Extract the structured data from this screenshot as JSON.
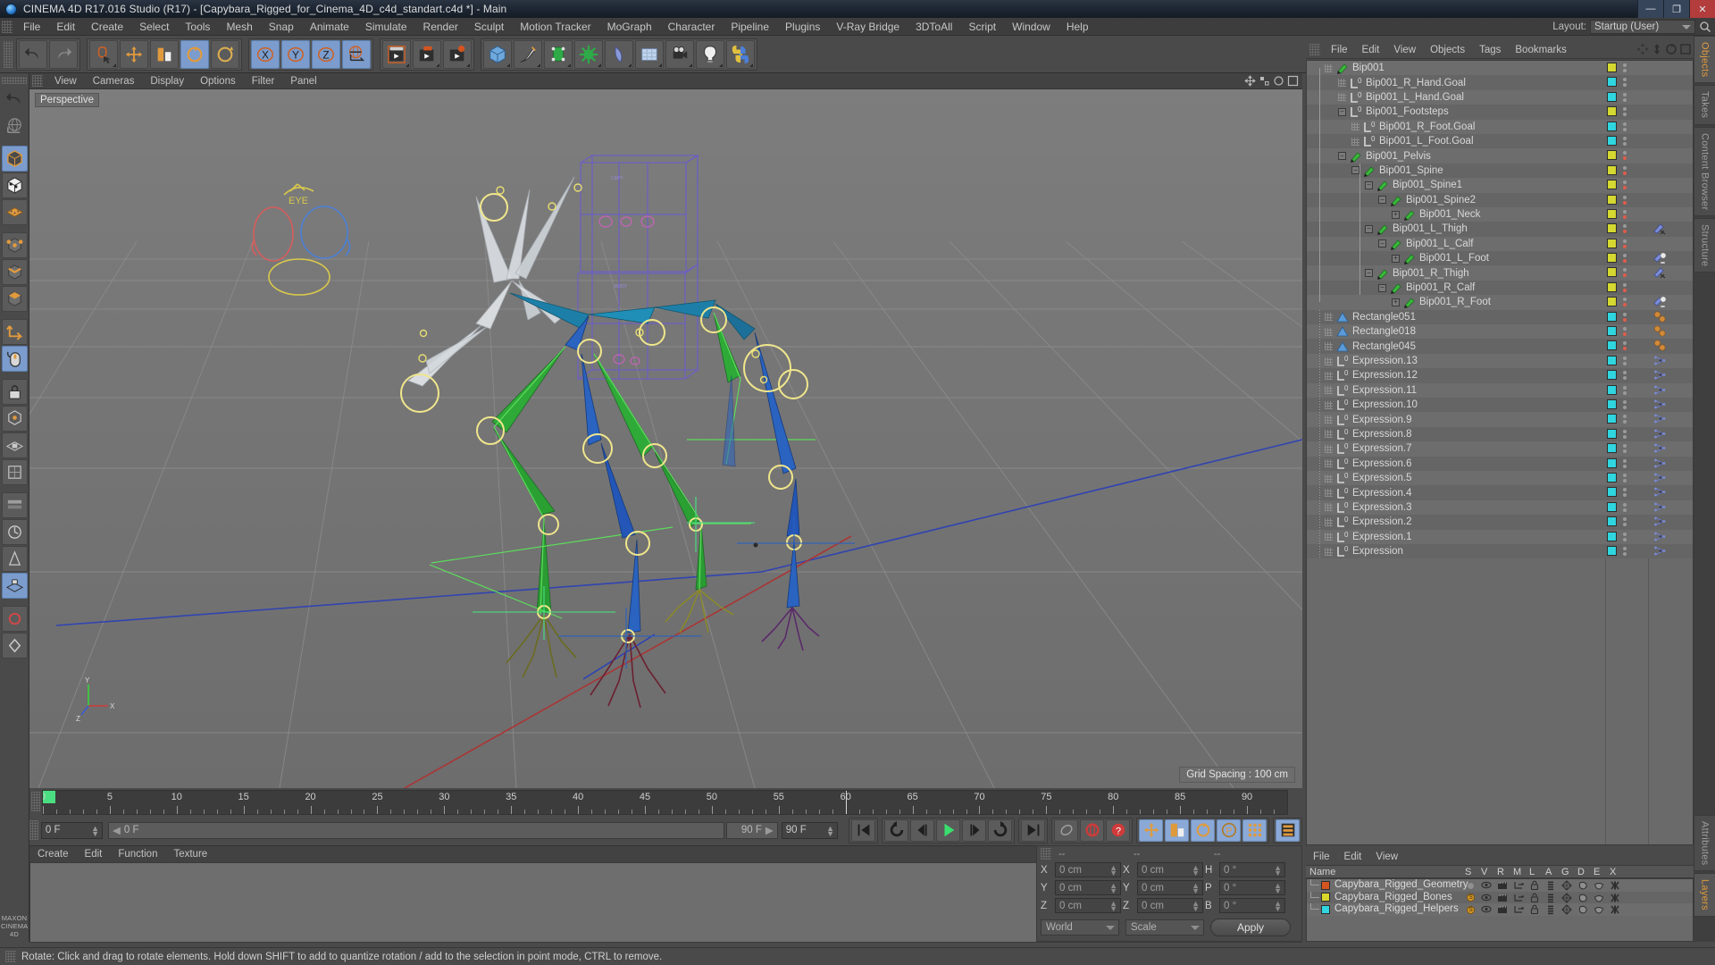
{
  "window": {
    "title": "CINEMA 4D R17.016 Studio (R17) - [Capybara_Rigged_for_Cinema_4D_c4d_standart.c4d *] - Main",
    "logo_icon": "cinema4d-logo-icon",
    "minimize_label": "—",
    "maximize_label": "❐",
    "close_label": "✕"
  },
  "menubar": {
    "items": [
      "File",
      "Edit",
      "Create",
      "Select",
      "Tools",
      "Mesh",
      "Snap",
      "Animate",
      "Simulate",
      "Render",
      "Sculpt",
      "Motion Tracker",
      "MoGraph",
      "Character",
      "Pipeline",
      "Plugins",
      "V-Ray Bridge",
      "3DToAll",
      "Script",
      "Window",
      "Help"
    ],
    "layout_label": "Layout:",
    "layout_value": "Startup (User)",
    "search_icon": "search-icon"
  },
  "toolbar": {
    "groups": [
      {
        "name": "history",
        "buttons": [
          {
            "icon": "undo-icon",
            "label": "Undo",
            "active": false
          },
          {
            "icon": "redo-icon",
            "label": "Redo",
            "active": false,
            "disabled": true
          }
        ]
      },
      {
        "name": "tools",
        "buttons": [
          {
            "icon": "live-selection-icon",
            "label": "Live Selection",
            "active": false
          },
          {
            "icon": "move-icon",
            "label": "Move",
            "active": false
          },
          {
            "icon": "scale-icon",
            "label": "Scale",
            "active": false
          },
          {
            "icon": "rotate-icon",
            "label": "Rotate",
            "active": true
          },
          {
            "icon": "rotate-alt-icon",
            "label": "Rotate Band",
            "active": false
          }
        ]
      },
      {
        "name": "axis-locks",
        "buttons": [
          {
            "icon": "x-axis-icon",
            "label": "X",
            "active": true
          },
          {
            "icon": "y-axis-icon",
            "label": "Y",
            "active": true
          },
          {
            "icon": "z-axis-icon",
            "label": "Z",
            "active": true
          },
          {
            "icon": "world-coordinate-icon",
            "label": "World/Object",
            "active": true
          }
        ]
      },
      {
        "name": "render",
        "buttons": [
          {
            "icon": "render-view-icon",
            "label": "Render View",
            "active": false
          },
          {
            "icon": "render-region-icon",
            "label": "Render to Picture Viewer",
            "active": false
          },
          {
            "icon": "render-settings-icon",
            "label": "Edit Render Settings",
            "active": false
          }
        ]
      },
      {
        "name": "create",
        "buttons": [
          {
            "icon": "cube-primitive-icon",
            "label": "Add Cube Object",
            "active": false
          },
          {
            "icon": "spline-pen-icon",
            "label": "Add Spline",
            "active": false
          },
          {
            "icon": "generator-icon",
            "label": "Add NURBS Object",
            "active": false
          },
          {
            "icon": "deformer-icon",
            "label": "Add Bend Object",
            "active": false
          },
          {
            "icon": "scene-object-icon",
            "label": "Add Floor Object",
            "active": false
          },
          {
            "icon": "environment-icon",
            "label": "Add Sky Object",
            "active": false
          },
          {
            "icon": "camera-icon",
            "label": "Add Camera Object",
            "active": false
          },
          {
            "icon": "light-icon",
            "label": "Add Light Object",
            "active": false
          },
          {
            "icon": "python-icon",
            "label": "Python Generator",
            "active": false
          }
        ]
      }
    ]
  },
  "left_toolbar": {
    "buttons": [
      {
        "icon": "undo-history-icon",
        "label": "Undo",
        "active": false
      },
      {
        "icon": "world-axis-icon",
        "label": "Make Editable",
        "active": false
      },
      {
        "icon": "model-mode-icon",
        "label": "Model Mode",
        "active": true
      },
      {
        "icon": "texture-mode-icon",
        "label": "Texture Mode",
        "active": false
      },
      {
        "icon": "grid-mode-icon",
        "label": "Workplane",
        "active": false
      },
      {
        "icon": "points-mode-icon",
        "label": "Points Mode",
        "active": false
      },
      {
        "icon": "edges-mode-icon",
        "label": "Edges Mode",
        "active": false
      },
      {
        "icon": "polygons-mode-icon",
        "label": "Polygons Mode",
        "active": false
      },
      {
        "icon": "object-axis-icon",
        "label": "Enable Axis Modification",
        "active": false
      },
      {
        "icon": "viewport-mouse-icon",
        "label": "Viewport Solo",
        "active": true
      },
      {
        "icon": "lock-axis-icon",
        "label": "Lock Axis",
        "active": false
      },
      {
        "icon": "snap-icon",
        "label": "Enable Snap",
        "active": false
      },
      {
        "icon": "workplane-lock-icon",
        "label": "Lock Workplane",
        "active": false
      },
      {
        "icon": "uv-icon",
        "label": "UV Mode",
        "active": false
      },
      {
        "icon": "animation-layer-icon",
        "label": "Animation Layer",
        "active": false
      },
      {
        "icon": "quantize-icon",
        "label": "Quantizing",
        "active": false
      },
      {
        "icon": "weight-icon",
        "label": "Weight Tool",
        "active": false
      },
      {
        "icon": "plane-lock-icon",
        "label": "Plane Lock",
        "active": true
      },
      {
        "icon": "record-icon",
        "label": "Record Active Objects",
        "active": false
      },
      {
        "icon": "keyframe-icon",
        "label": "Autokeying",
        "active": false
      }
    ],
    "brand_line1": "MAXON",
    "brand_line2": "CINEMA 4D"
  },
  "viewport": {
    "menu": [
      "View",
      "Cameras",
      "Display",
      "Options",
      "Filter",
      "Panel"
    ],
    "view_label": "Perspective",
    "grid_spacing": "Grid Spacing : 100 cm",
    "axis_labels": {
      "x": "X",
      "y": "Y",
      "z": "Z"
    },
    "nav_icons": [
      "viewport-move-icon",
      "viewport-scale-icon",
      "viewport-rotate-icon",
      "viewport-maximize-icon"
    ]
  },
  "timeline": {
    "ticks": [
      0,
      5,
      10,
      15,
      20,
      25,
      30,
      35,
      40,
      45,
      50,
      55,
      60,
      65,
      70,
      75,
      80,
      85,
      90
    ],
    "current_frame_marker": 0,
    "playhead_frame": 60,
    "range_start": "0 F",
    "range_end": "90 F",
    "current_field": "0 F",
    "preview_field": "0 F",
    "endtime_field": "90 F",
    "endtime_field2": "90 F",
    "topright_field": "0 F"
  },
  "playback": {
    "buttons": [
      {
        "icon": "go-to-start-icon",
        "label": "Go to Start",
        "active": false
      },
      {
        "icon": "previous-keyframe-icon",
        "label": "Go to Previous Keyframe",
        "active": false
      },
      {
        "icon": "step-back-icon",
        "label": "Go to Previous Frame",
        "active": false
      },
      {
        "icon": "play-icon",
        "label": "Play Forwards",
        "active": false
      },
      {
        "icon": "step-forward-icon",
        "label": "Go to Next Frame",
        "active": false
      },
      {
        "icon": "next-keyframe-icon",
        "label": "Go to Next Keyframe",
        "active": false
      },
      {
        "icon": "go-to-end-icon",
        "label": "Go to End",
        "active": false
      },
      {
        "icon": "record-active-icon",
        "label": "Record Active Objects",
        "active": false
      },
      {
        "icon": "autokeying-icon",
        "label": "Autokeying",
        "active": false
      },
      {
        "icon": "keyframe-selection-icon",
        "label": "Keyframe Selection",
        "active": false
      }
    ],
    "param_buttons": [
      {
        "icon": "position-key-icon",
        "label": "Position",
        "active": true
      },
      {
        "icon": "scale-key-icon",
        "label": "Scale",
        "active": true
      },
      {
        "icon": "rotation-key-icon",
        "label": "Rotation",
        "active": true
      },
      {
        "icon": "pla-key-icon",
        "label": "Point Level Animation",
        "active": true
      },
      {
        "icon": "parameter-key-icon",
        "label": "Parameter",
        "active": true
      }
    ],
    "timeline_toggle": {
      "icon": "timeline-icon",
      "label": "Animate Mode",
      "active": true
    }
  },
  "material_manager": {
    "menu": [
      "Create",
      "Edit",
      "Function",
      "Texture"
    ],
    "materials": []
  },
  "coordinate_manager": {
    "header": [
      "--",
      "--",
      "--"
    ],
    "rows": [
      {
        "pos_label": "X",
        "pos_value": "0 cm",
        "size_label": "X",
        "size_value": "0 cm",
        "rot_label": "H",
        "rot_value": "0 °"
      },
      {
        "pos_label": "Y",
        "pos_value": "0 cm",
        "size_label": "Y",
        "size_value": "0 cm",
        "rot_label": "P",
        "rot_value": "0 °"
      },
      {
        "pos_label": "Z",
        "pos_value": "0 cm",
        "size_label": "Z",
        "size_value": "0 cm",
        "rot_label": "B",
        "rot_value": "0 °"
      }
    ],
    "system_dropdown": "World",
    "mode_dropdown": "Scale",
    "apply_label": "Apply"
  },
  "object_manager": {
    "menu": [
      "File",
      "Edit",
      "View",
      "Objects",
      "Tags",
      "Bookmarks"
    ],
    "tools": [
      "om-move-icon",
      "om-updown-icon",
      "om-rotate-icon",
      "om-filter-icon"
    ],
    "items": [
      {
        "name": "Bip001",
        "depth": 0,
        "icon": "joint-icon",
        "expander": "dots",
        "swatch": "#d4d830",
        "dot": "none",
        "tag": "none"
      },
      {
        "name": "Bip001_R_Hand.Goal",
        "depth": 1,
        "icon": "null-object-icon",
        "expander": "none",
        "swatch": "#2fd6e0",
        "dot": "none",
        "tag": "none"
      },
      {
        "name": "Bip001_L_Hand.Goal",
        "depth": 1,
        "icon": "null-object-icon",
        "expander": "none",
        "swatch": "#2fd6e0",
        "dot": "none",
        "tag": "none"
      },
      {
        "name": "Bip001_Footsteps",
        "depth": 1,
        "icon": "null-object-icon",
        "expander": "minus",
        "swatch": "#d4d830",
        "dot": "none",
        "tag": "none"
      },
      {
        "name": "Bip001_R_Foot.Goal",
        "depth": 2,
        "icon": "null-object-icon",
        "expander": "none",
        "swatch": "#2fd6e0",
        "dot": "none",
        "tag": "none"
      },
      {
        "name": "Bip001_L_Foot.Goal",
        "depth": 2,
        "icon": "null-object-icon",
        "expander": "none",
        "swatch": "#2fd6e0",
        "dot": "none",
        "tag": "none"
      },
      {
        "name": "Bip001_Pelvis",
        "depth": 1,
        "icon": "joint-icon",
        "expander": "minus",
        "swatch": "#d4d830",
        "dot": "#e05c4a",
        "tag": "none"
      },
      {
        "name": "Bip001_Spine",
        "depth": 2,
        "icon": "joint-icon",
        "expander": "minus",
        "swatch": "#d4d830",
        "dot": "#e05c4a",
        "tag": "none"
      },
      {
        "name": "Bip001_Spine1",
        "depth": 3,
        "icon": "joint-icon",
        "expander": "minus",
        "swatch": "#d4d830",
        "dot": "#e05c4a",
        "tag": "none"
      },
      {
        "name": "Bip001_Spine2",
        "depth": 4,
        "icon": "joint-icon",
        "expander": "minus",
        "swatch": "#d4d830",
        "dot": "#e05c4a",
        "tag": "none"
      },
      {
        "name": "Bip001_Neck",
        "depth": 5,
        "icon": "joint-icon",
        "expander": "plus",
        "swatch": "#d4d830",
        "dot": "#e05c4a",
        "tag": "none"
      },
      {
        "name": "Bip001_L_Thigh",
        "depth": 3,
        "icon": "joint-icon",
        "expander": "minus",
        "swatch": "#d4d830",
        "dot": "#e05c4a",
        "tag": "ik-tag-icon"
      },
      {
        "name": "Bip001_L_Calf",
        "depth": 4,
        "icon": "joint-icon",
        "expander": "minus",
        "swatch": "#d4d830",
        "dot": "#e05c4a",
        "tag": "none"
      },
      {
        "name": "Bip001_L_Foot",
        "depth": 5,
        "icon": "joint-icon",
        "expander": "plus",
        "swatch": "#d4d830",
        "dot": "#e05c4a",
        "tag": "ik-goal-tag-icon"
      },
      {
        "name": "Bip001_R_Thigh",
        "depth": 3,
        "icon": "joint-icon",
        "expander": "minus",
        "swatch": "#d4d830",
        "dot": "#e05c4a",
        "tag": "ik-tag-icon"
      },
      {
        "name": "Bip001_R_Calf",
        "depth": 4,
        "icon": "joint-icon",
        "expander": "minus",
        "swatch": "#d4d830",
        "dot": "#e05c4a",
        "tag": "none"
      },
      {
        "name": "Bip001_R_Foot",
        "depth": 5,
        "icon": "joint-icon",
        "expander": "plus",
        "swatch": "#d4d830",
        "dot": "#e05c4a",
        "tag": "ik-goal-tag-icon"
      },
      {
        "name": "Rectangle051",
        "depth": 0,
        "icon": "spline-icon",
        "expander": "dots",
        "swatch": "#2fd6e0",
        "dot": "#e05c4a",
        "tag": "sphere-tags-icon"
      },
      {
        "name": "Rectangle018",
        "depth": 0,
        "icon": "spline-icon",
        "expander": "dots",
        "swatch": "#2fd6e0",
        "dot": "#e05c4a",
        "tag": "sphere-tags-icon"
      },
      {
        "name": "Rectangle045",
        "depth": 0,
        "icon": "spline-icon",
        "expander": "dots",
        "swatch": "#2fd6e0",
        "dot": "#e05c4a",
        "tag": "sphere-tags-icon"
      },
      {
        "name": "Expression.13",
        "depth": 0,
        "icon": "null-object-icon",
        "expander": "dots",
        "swatch": "#2fd6e0",
        "dot": "none",
        "tag": "xpresso-tag-icon"
      },
      {
        "name": "Expression.12",
        "depth": 0,
        "icon": "null-object-icon",
        "expander": "dots",
        "swatch": "#2fd6e0",
        "dot": "none",
        "tag": "xpresso-tag-icon"
      },
      {
        "name": "Expression.11",
        "depth": 0,
        "icon": "null-object-icon",
        "expander": "dots",
        "swatch": "#2fd6e0",
        "dot": "none",
        "tag": "xpresso-tag-icon"
      },
      {
        "name": "Expression.10",
        "depth": 0,
        "icon": "null-object-icon",
        "expander": "dots",
        "swatch": "#2fd6e0",
        "dot": "none",
        "tag": "xpresso-tag-icon"
      },
      {
        "name": "Expression.9",
        "depth": 0,
        "icon": "null-object-icon",
        "expander": "dots",
        "swatch": "#2fd6e0",
        "dot": "none",
        "tag": "xpresso-tag-icon"
      },
      {
        "name": "Expression.8",
        "depth": 0,
        "icon": "null-object-icon",
        "expander": "dots",
        "swatch": "#2fd6e0",
        "dot": "none",
        "tag": "xpresso-tag-icon"
      },
      {
        "name": "Expression.7",
        "depth": 0,
        "icon": "null-object-icon",
        "expander": "dots",
        "swatch": "#2fd6e0",
        "dot": "none",
        "tag": "xpresso-tag-icon"
      },
      {
        "name": "Expression.6",
        "depth": 0,
        "icon": "null-object-icon",
        "expander": "dots",
        "swatch": "#2fd6e0",
        "dot": "none",
        "tag": "xpresso-tag-icon"
      },
      {
        "name": "Expression.5",
        "depth": 0,
        "icon": "null-object-icon",
        "expander": "dots",
        "swatch": "#2fd6e0",
        "dot": "none",
        "tag": "xpresso-tag-icon"
      },
      {
        "name": "Expression.4",
        "depth": 0,
        "icon": "null-object-icon",
        "expander": "dots",
        "swatch": "#2fd6e0",
        "dot": "none",
        "tag": "xpresso-tag-icon"
      },
      {
        "name": "Expression.3",
        "depth": 0,
        "icon": "null-object-icon",
        "expander": "dots",
        "swatch": "#2fd6e0",
        "dot": "none",
        "tag": "xpresso-tag-icon"
      },
      {
        "name": "Expression.2",
        "depth": 0,
        "icon": "null-object-icon",
        "expander": "dots",
        "swatch": "#2fd6e0",
        "dot": "none",
        "tag": "xpresso-tag-icon"
      },
      {
        "name": "Expression.1",
        "depth": 0,
        "icon": "null-object-icon",
        "expander": "dots",
        "swatch": "#2fd6e0",
        "dot": "none",
        "tag": "xpresso-tag-icon"
      },
      {
        "name": "Expression",
        "depth": 0,
        "icon": "null-object-icon",
        "expander": "dots",
        "swatch": "#2fd6e0",
        "dot": "none",
        "tag": "xpresso-tag-icon"
      }
    ]
  },
  "layer_manager": {
    "menu": [
      "File",
      "Edit",
      "View"
    ],
    "columns": [
      "Name",
      "S",
      "V",
      "R",
      "M",
      "L",
      "A",
      "G",
      "D",
      "E",
      "X"
    ],
    "rows": [
      {
        "name": "Capybara_Rigged_Geometry",
        "color": "#d4541f",
        "solo": "off"
      },
      {
        "name": "Capybara_Rigged_Bones",
        "color": "#d8d82c",
        "solo": "on"
      },
      {
        "name": "Capybara_Rigged_Helpers",
        "color": "#2fd6e0",
        "solo": "on"
      }
    ]
  },
  "vertical_tabs": [
    {
      "label": "Objects",
      "active": true
    },
    {
      "label": "Takes",
      "active": false
    },
    {
      "label": "Content Browser",
      "active": false
    },
    {
      "label": "Structure",
      "active": false
    }
  ],
  "right_lower_tabs": [
    {
      "label": "Attributes",
      "active": false
    },
    {
      "label": "Layers",
      "active": true
    }
  ],
  "statusbar": {
    "text": "Rotate: Click and drag to rotate elements. Hold down SHIFT to add to quantize rotation / add to the selection in point mode, CTRL to remove."
  },
  "colors": {
    "accent_orange": "#e09a3e",
    "bone_yellow": "#d4d830",
    "helper_cyan": "#2fd6e0",
    "geometry_orange": "#d4541f",
    "selection_blue": "#7b9ccc",
    "bone_green": "#2fb03a",
    "bone_blue": "#2060c8",
    "ik_handle_yellow": "#f0e68c"
  }
}
